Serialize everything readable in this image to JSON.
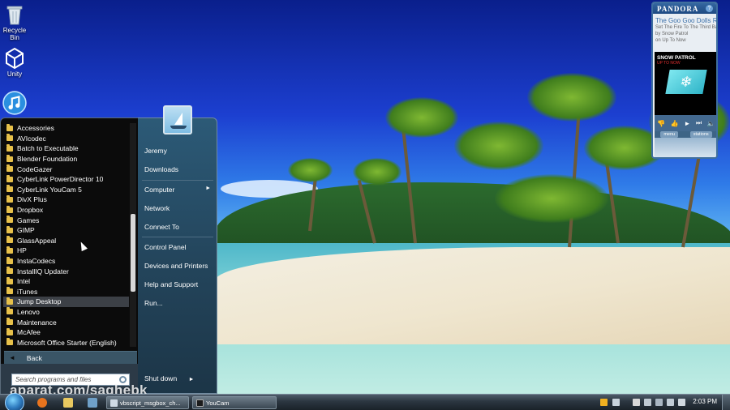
{
  "desktop": {
    "icons": [
      {
        "label": "Recycle Bin",
        "icon": "recycle-bin-icon"
      },
      {
        "label": "Unity",
        "icon": "unity-icon"
      },
      {
        "label": "",
        "icon": "itunes-icon"
      }
    ]
  },
  "start_menu": {
    "programs": [
      "Accessories",
      "AVIcodec",
      "Batch to Executable",
      "Blender Foundation",
      "CodeGazer",
      "CyberLink PowerDirector 10",
      "CyberLink YouCam 5",
      "DivX Plus",
      "Dropbox",
      "Games",
      "GIMP",
      "GlassAppeal",
      "HP",
      "InstaCodecs",
      "InstallIQ Updater",
      "Intel",
      "iTunes",
      "Jump Desktop",
      "Lenovo",
      "Maintenance",
      "McAfee",
      "Microsoft Office Starter (English)"
    ],
    "highlighted_program": "Jump Desktop",
    "back_label": "Back",
    "search_placeholder": "Search programs and files",
    "right_items": {
      "user": "Jeremy",
      "downloads": "Downloads",
      "computer": "Computer",
      "network": "Network",
      "connect_to": "Connect To",
      "control_panel": "Control Panel",
      "devices_printers": "Devices and Printers",
      "help_support": "Help and Support",
      "run": "Run..."
    },
    "shutdown_label": "Shut down"
  },
  "pandora": {
    "logo": "PANDORA",
    "help": "?",
    "song_title": "The Goo Goo Dolls Ra",
    "meta_line1": "Set The Fire To The Third Bar f",
    "meta_line2": "by Snow Patrol",
    "meta_line3": "on Up To Now",
    "album_artist": "SNOW PATROL",
    "album_sub": "UP TO NOW",
    "tab_menu": "menu",
    "tab_stations": "stations"
  },
  "taskbar": {
    "buttons": [
      {
        "label": "vbscript_msgbox_ch...",
        "icon": "notepad-icon"
      },
      {
        "label": "YouCam",
        "icon": "youcam-icon"
      }
    ],
    "clock": "2:03 PM"
  },
  "watermark": "aparat.com/saghebk",
  "colors": {
    "start_menu_left_bg": "#0b0b0b",
    "start_menu_right_bg": "#2c5a77",
    "folder_yellow": "#e7c14a",
    "pandora_blue": "#3466a0"
  }
}
